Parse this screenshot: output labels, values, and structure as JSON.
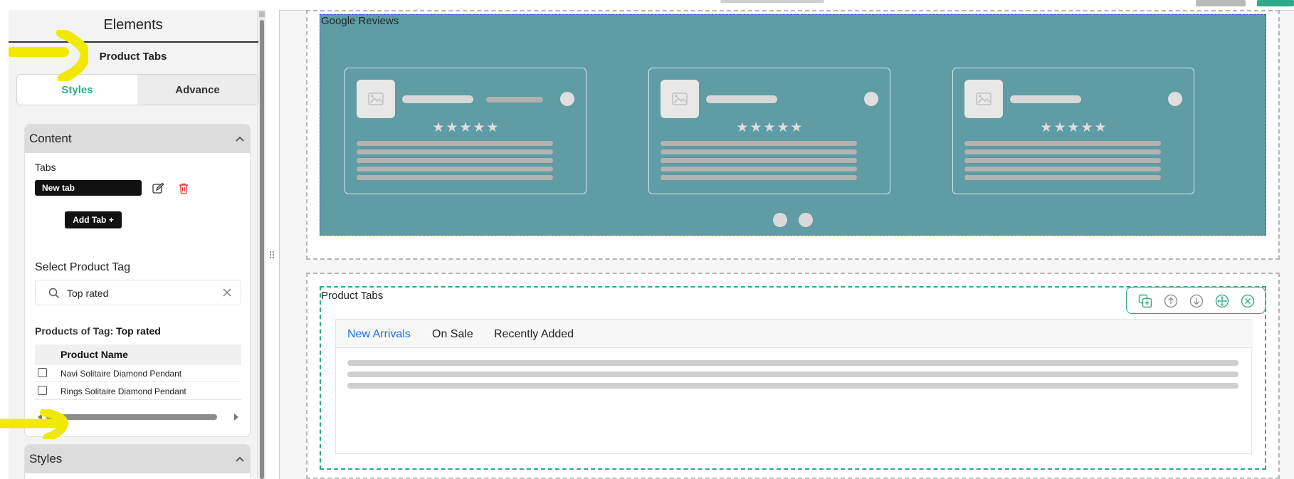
{
  "sidebar": {
    "title": "Elements",
    "subtitle": "Product Tabs",
    "tabs": [
      {
        "label": "Styles",
        "active": true
      },
      {
        "label": "Advance",
        "active": false
      }
    ],
    "content_section": {
      "title": "Content",
      "tabs_label": "Tabs",
      "tab_item": "New tab",
      "add_tab_label": "Add Tab +",
      "select_tag_label": "Select Product Tag",
      "search_value": "Top rated",
      "products_of_tag_prefix": "Products of Tag: ",
      "products_of_tag_name": "Top rated",
      "table_header": "Product Name",
      "products": [
        "Navi Solitaire Diamond Pendant",
        "Rings Solitaire Diamond Pendant"
      ]
    },
    "styles_section": {
      "title": "Styles"
    }
  },
  "canvas": {
    "reviews": {
      "label": "Google Reviews",
      "star_text": "★★★★★"
    },
    "product_tabs": {
      "label": "Product Tabs",
      "tabs": [
        "New Arrivals",
        "On Sale",
        "Recently Added"
      ],
      "active_tab": "New Arrivals"
    }
  },
  "colors": {
    "accent_green": "#2eaa86",
    "reviews_bg": "#5f9ca3",
    "active_tab_blue": "#1a73e8",
    "annotation_yellow": "#f2e900"
  },
  "icons": {
    "edit": "edit-icon",
    "delete": "trash-icon",
    "search": "search-icon",
    "clear": "close-icon",
    "duplicate": "duplicate-icon",
    "move_up": "arrow-up-icon",
    "move_down": "arrow-down-icon",
    "move": "move-icon",
    "remove": "close-icon"
  }
}
